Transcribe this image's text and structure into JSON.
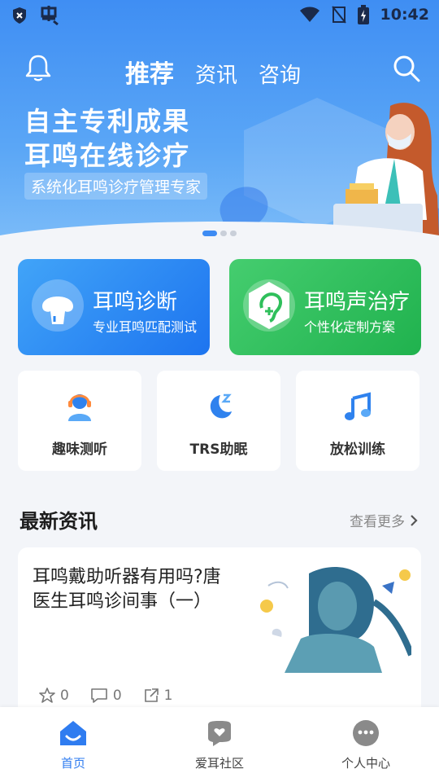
{
  "status": {
    "left_icons": [
      "shield-icon",
      "bug-icon"
    ],
    "time": "10:42",
    "right_icons": [
      "wifi-icon",
      "no-signal-icon",
      "battery-icon"
    ]
  },
  "header": {
    "tabs": [
      {
        "label": "推荐",
        "active": true
      },
      {
        "label": "资讯",
        "active": false
      },
      {
        "label": "咨询",
        "active": false
      }
    ],
    "icons": [
      "bell-icon",
      "search-icon"
    ]
  },
  "banner": {
    "line1": "自主专利成果",
    "line2": "耳鸣在线诊疗",
    "subtitle": "系统化耳鸣诊疗管理专家",
    "page_count": 3,
    "active_page": 1
  },
  "features": [
    {
      "title": "耳鸣诊断",
      "subtitle": "专业耳鸣匹配测试",
      "icon": "mushroom-icon",
      "color": "#2a86f2"
    },
    {
      "title": "耳鸣声治疗",
      "subtitle": "个性化定制方案",
      "icon": "ear-plus-icon",
      "color": "#2fbf5b"
    }
  ],
  "tools": [
    {
      "label": "趣味测听",
      "icon": "headset-person-icon"
    },
    {
      "label": "TRS助眠",
      "icon": "moon-sleep-icon"
    },
    {
      "label": "放松训练",
      "icon": "music-note-icon"
    }
  ],
  "news_section": {
    "title": "最新资讯",
    "more": "查看更多"
  },
  "news": [
    {
      "title": "耳鸣戴助听器有用吗?唐医生耳鸣诊间事（一）",
      "likes": "0",
      "comments": "0",
      "shares": "1"
    }
  ],
  "bottom_nav": [
    {
      "label": "首页",
      "icon": "home-icon",
      "active": true
    },
    {
      "label": "爱耳社区",
      "icon": "community-chat-icon",
      "active": false
    },
    {
      "label": "个人中心",
      "icon": "profile-chat-icon",
      "active": false
    }
  ],
  "colors": {
    "accent": "#2f7cf0",
    "green": "#2fbf5b",
    "hero": "#4a97f4"
  }
}
